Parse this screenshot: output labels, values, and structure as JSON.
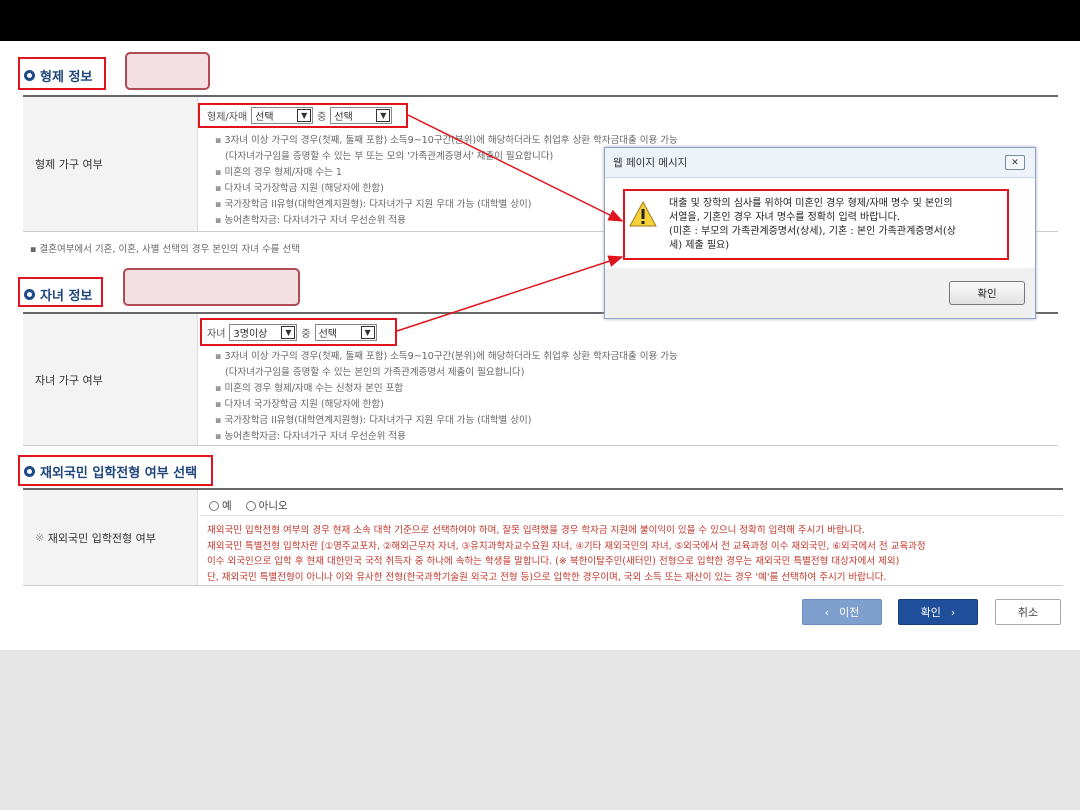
{
  "sibling_section": {
    "title": "형제 정보",
    "row_label": "형제 가구 여부",
    "select_prefix": "형제/자매",
    "select1_value": "선택",
    "select_middle": "중",
    "select2_value": "선택",
    "notes": [
      "3자녀 이상 가구의 경우(첫째, 둘째 포함) 소득9~10구간(분위)에 해당하더라도 취업후 상환 학자금대출 이용 가능",
      "(다자녀가구임을 증명할 수 있는 부 또는 모의 '가족관계증명서' 제출이 필요합니다)",
      "미혼의 경우 형제/자매 수는 1",
      "다자녀 국가장학금 지원 (해당자에 한함)",
      "국가장학금 II유형(대학연계지원형): 다자녀가구 지원 우대 가능 (대학별 상이)",
      "농어촌학자금: 다자녀가구 자녀 우선순위 적용"
    ],
    "footnote": "결혼여부에서 기혼, 이혼, 사별 선택의 경우 본인의 자녀 수를 선택"
  },
  "child_section": {
    "title": "자녀 정보",
    "row_label": "자녀 가구 여부",
    "select_prefix": "자녀",
    "select1_value": "3명이상",
    "select_middle": "중",
    "select2_value": "선택",
    "notes": [
      "3자녀 이상 가구의 경우(첫째, 둘째 포함) 소득9~10구간(분위)에 해당하더라도 취업후 상환 학자금대출 이용 가능",
      "(다자녀가구임을 증명할 수 있는 본인의 가족관계증명서 제출이 필요합니다)",
      "미혼의 경우 형제/자매 수는 신청자 본인 포함",
      "다자녀 국가장학금 지원 (해당자에 한함)",
      "국가장학금 II유형(대학연계지원형): 다자녀가구 지원 우대 가능 (대학별 상이)",
      "농어촌학자금: 다자녀가구 자녀 우선순위 적용"
    ]
  },
  "foreign_section": {
    "title": "재외국민 입학전형 여부 선택",
    "row_label": "재외국민 입학전형 여부",
    "radio_yes": "예",
    "radio_no": "아니오",
    "red_lines": [
      "재외국민 입학전형 여부의 경우 현재 소속 대학 기준으로 선택하여야 하며, 잘못 입력했을 경우 학자금 지원에 불이익이 있을 수 있으니 정확히 입력해 주시기 바랍니다.",
      "재외국민 특별전형 입학자란 [①영주교포자, ②해외근무자 자녀, ③유치과학자교수요원 자녀, ④기타 재외국민의 자녀, ⑤외국에서 전 교육과정 이수 재외국민, ⑥외국에서 전 교육과정",
      "이수 외국인으로 입학 후 현재 대한민국 국적 취득자 중 하나에 속하는 학생을 말합니다. (※ 북한이탈주민(새터민) 전형으로 입학한 경우는 재외국민 특별전형 대상자에서 제외)",
      "단, 재외국민 특별전형이 아니나 이와 유사한 전형(한국과학기술원 외국고 전형 등)으로 입학한 경우이며, 국외 소득 또는 재산이 있는 경우 '예'를 선택하여 주시기 바랍니다."
    ]
  },
  "buttons": {
    "prev": "이전",
    "confirm": "확인",
    "cancel": "취소"
  },
  "dialog": {
    "title": "웹 페이지 메시지",
    "message_lines": [
      "대출 및 장학의 심사를 위하여 미혼인 경우 형제/자매 명수 및 본인의",
      "서열을, 기혼인 경우 자녀 명수를 정확히 입력 바랍니다.",
      "(미혼 : 부모의 가족관계증명서(상세), 기혼 : 본인 가족관계증명서(상",
      "세) 제출 필요)"
    ],
    "ok": "확인"
  },
  "colors": {
    "annotation_red": "#e0141c",
    "section_title": "#20467d",
    "primary_button": "#1f4f9a",
    "secondary_button": "#7f9fcf",
    "warning_text": "#c0362b"
  }
}
